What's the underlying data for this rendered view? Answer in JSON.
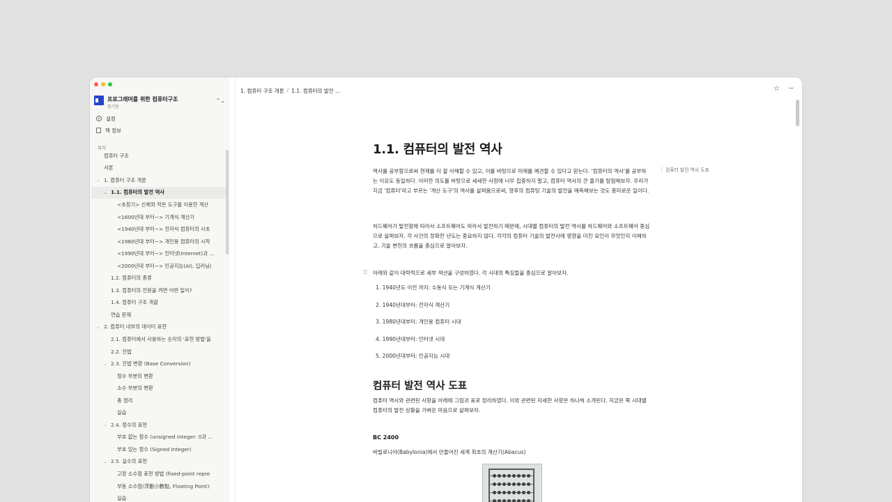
{
  "window": {
    "traffic_lights": [
      "close",
      "minimize",
      "zoom"
    ]
  },
  "sidebar": {
    "book_title": "프로그래머를 위한 컴퓨터구조",
    "book_author": "정기형",
    "switch_icon": "⌃⌄",
    "links": [
      {
        "label": "설정",
        "icon": "gear-icon"
      },
      {
        "label": "책 정보",
        "icon": "document-icon"
      }
    ],
    "toc_label": "목차",
    "toc": [
      {
        "label": "컴퓨터 구조",
        "level": 0,
        "caret": ""
      },
      {
        "label": "서론",
        "level": 0,
        "caret": ""
      },
      {
        "label": "1. 컴퓨터 구조 개론",
        "level": 0,
        "caret": "⌄"
      },
      {
        "label": "1.1. 컴퓨터의 발전 역사",
        "level": 1,
        "caret": "⌄",
        "active": true
      },
      {
        "label": "<초창기> 신체와 작은 도구를 이용한 계산",
        "level": 2,
        "caret": ""
      },
      {
        "label": "<1600년대 부터~> 기계식 계산기",
        "level": 2,
        "caret": ""
      },
      {
        "label": "<1940년대 부터~> 전자식 컴퓨터의 시초",
        "level": 2,
        "caret": ""
      },
      {
        "label": "<1980년대 부터~> 개인용 컴퓨터의 시작",
        "level": 2,
        "caret": ""
      },
      {
        "label": "<1990년대 부터~> 인터넷(Internet)과 ...",
        "level": 2,
        "caret": ""
      },
      {
        "label": "<2000년대 부터~> 인공지능(AI), 딥러닝(",
        "level": 2,
        "caret": ""
      },
      {
        "label": "1.2. 컴퓨터의 종류",
        "level": 1,
        "caret": ""
      },
      {
        "label": "1.3. 컴퓨터의 전원을 켜면 어떤 일이?",
        "level": 1,
        "caret": ""
      },
      {
        "label": "1.4. 컴퓨터 구조 개괄",
        "level": 1,
        "caret": ""
      },
      {
        "label": "연습 문제",
        "level": 1,
        "caret": ""
      },
      {
        "label": "2. 컴퓨터 내부의 데이터 표현",
        "level": 0,
        "caret": "⌄"
      },
      {
        "label": "2.1. 컴퓨터에서 사용하는 숫자의 '표현 방법'을",
        "level": 1,
        "caret": ""
      },
      {
        "label": "2.2. 진법",
        "level": 1,
        "caret": ""
      },
      {
        "label": "2.3. 진법 변환 (Base Conversion)",
        "level": 1,
        "caret": "⌄"
      },
      {
        "label": "정수 부분의 변환",
        "level": 2,
        "caret": ""
      },
      {
        "label": "소수 부분의 변환",
        "level": 2,
        "caret": ""
      },
      {
        "label": "총 정리",
        "level": 2,
        "caret": ""
      },
      {
        "label": "실습",
        "level": 2,
        "caret": ""
      },
      {
        "label": "2.4. 정수의 표현",
        "level": 1,
        "caret": "⌄"
      },
      {
        "label": "부호 없는 정수 (unsigned integer: 0과 ...",
        "level": 2,
        "caret": ""
      },
      {
        "label": "부호 있는 정수 (Signed Integer)",
        "level": 2,
        "caret": ""
      },
      {
        "label": "2.5. 실수의 표현",
        "level": 1,
        "caret": "⌄"
      },
      {
        "label": "고정 소수점 표현 방법 (fixed-point repre",
        "level": 2,
        "caret": ""
      },
      {
        "label": "부동 소수점(浮動小數點, Floating Point)",
        "level": 2,
        "caret": ""
      },
      {
        "label": "실습",
        "level": 2,
        "caret": ""
      }
    ]
  },
  "topbar": {
    "breadcrumbs": [
      "1. 컴퓨터 구조 개론",
      "1.1. 컴퓨터의 발전 ..."
    ],
    "separator": "/",
    "star_icon": "☆",
    "more_icon": "···"
  },
  "page": {
    "title": "1.1. 컴퓨터의 발전 역사",
    "para1": "역사를 공부함으로써 현재를 더 잘 이해할 수 있고, 이를 바탕으로 미래를 예견할 수 있다고 믿는다. '컴퓨터의 역사'를 공부하는 이유도 동일하다. 이러한 의도를 바탕으로 세세한 사항에 너무 집중하지 말고, 컴퓨터 역사의 큰 줄기를 탐험해보자. 우리가 지금 '컴퓨터'라고 부르는 '계산 도구'의 역사를 살펴봄으로써, 향후의 컴퓨팅 기술의 발전을 예측해보는 것도 흥미로운 일이다.",
    "para2": "하드웨어가 발전함에 따라서 소프트웨어도 따라서 발전하기 때문에, 시대별 컴퓨터의 발전 역사를 하드웨어와 소프트웨어 중심으로 살펴보자. 각 사건의 정확한 년도는 중요하지 않다. 각각의 컴퓨터 기술의 발전사에 영향을 미친 요인이 무엇인지 이해하고, 기술 변천의 흐름을 중심으로 알아보자.",
    "drag_handle": "⠿",
    "para3": "아래와 같이 대략적으로 세부 섹션을 구성하였다. 각 시대의 특징들을 중심으로 알아보자.",
    "list": [
      "1. 1940년도 이전 까지: 수동식 또는 기계식 계산기",
      "2. 1940년대부터: 전자식 계산기",
      "3. 1980년대부터: 개인용 컴퓨터 시대",
      "4. 1990년대부터: 인터넷 시대",
      "5. 2000년대부터: 인공지능 시대"
    ],
    "h2": "컴퓨터 발전 역사 도표",
    "para4": "컴퓨터 역사와 관련된 사항을 아래에 그림과 표로 정리하였다. 이와 관련된 자세한 사항은 하나씩 소개된다. 지금은 쭉 시대별 컴퓨터의 발전 상황을 가벼운 마음으로 살펴보자.",
    "h4": "BC 2400",
    "para5": "바빌로니아(Babylonia)에서 만들어진 세계 최초의 계산기(Abacus)",
    "image_icon": "abacus-image",
    "aside_link": "컴퓨터 발전 역사 도표",
    "help": "?"
  }
}
